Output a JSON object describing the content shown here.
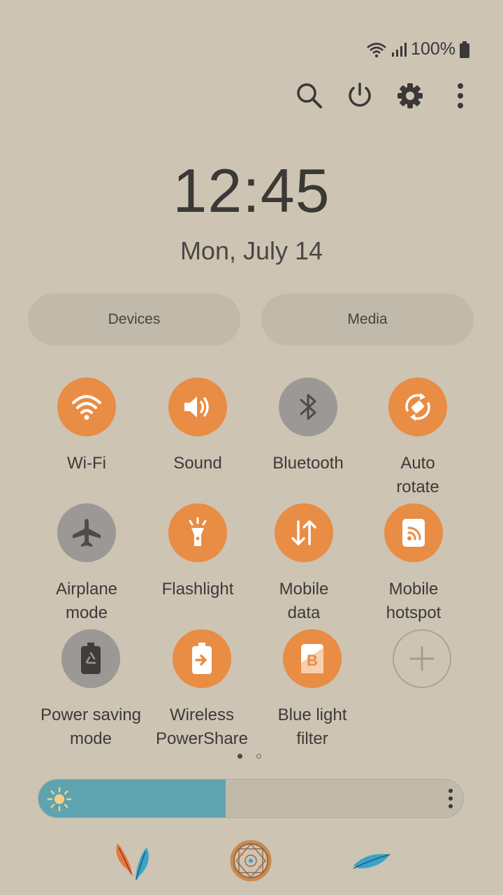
{
  "status": {
    "battery": "100%",
    "icons": [
      "wifi-icon",
      "signal-icon",
      "battery-icon"
    ]
  },
  "toolbar": {
    "icons": [
      "search-icon",
      "power-icon",
      "settings-icon",
      "more-icon"
    ]
  },
  "clock": {
    "time": "12:45",
    "date": "Mon, July 14"
  },
  "buttons": {
    "devices": "Devices",
    "media": "Media"
  },
  "tiles": [
    {
      "label": "Wi-Fi",
      "state": "on",
      "icon": "wifi-icon"
    },
    {
      "label": "Sound",
      "state": "on",
      "icon": "speaker-icon"
    },
    {
      "label": "Bluetooth",
      "state": "off",
      "icon": "bluetooth-icon"
    },
    {
      "label": "Auto\nrotate",
      "state": "on",
      "icon": "rotate-icon"
    },
    {
      "label": "Airplane\nmode",
      "state": "off",
      "icon": "airplane-icon"
    },
    {
      "label": "Flashlight",
      "state": "on",
      "icon": "flashlight-icon"
    },
    {
      "label": "Mobile\ndata",
      "state": "on",
      "icon": "mobile-data-icon"
    },
    {
      "label": "Mobile\nhotspot",
      "state": "on",
      "icon": "hotspot-icon"
    },
    {
      "label": "Power saving\nmode",
      "state": "off",
      "icon": "power-saving-icon"
    },
    {
      "label": "Wireless\nPowerShare",
      "state": "on",
      "icon": "powershare-icon"
    },
    {
      "label": "Blue light\nfilter",
      "state": "on",
      "icon": "blue-light-icon"
    }
  ],
  "pager": {
    "pages": 2,
    "current": 1
  },
  "brightness": {
    "level": 0.44
  },
  "colors": {
    "accent": "#e98c44",
    "off": "#9b9895",
    "background": "#cdc4b4",
    "brightness": "#5da3b0"
  }
}
